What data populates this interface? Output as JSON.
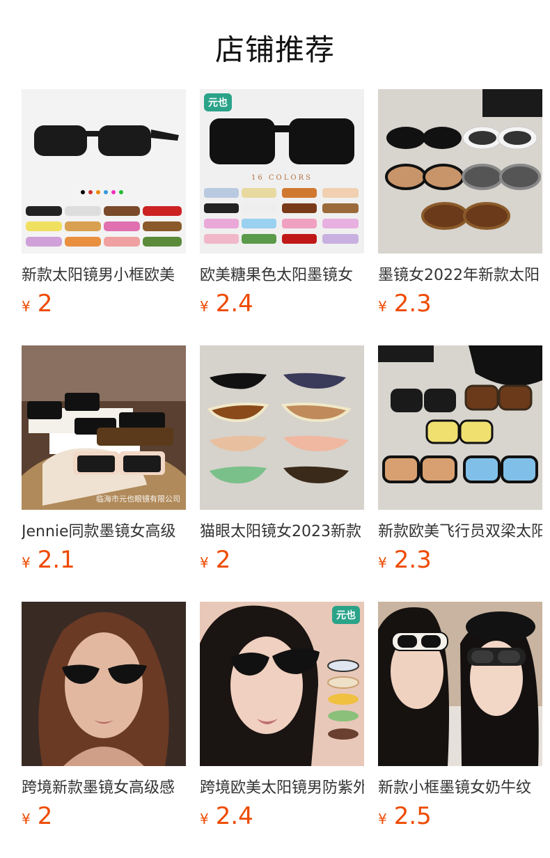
{
  "header": {
    "title": "店铺推荐"
  },
  "currency": "¥",
  "products": [
    {
      "name": "新款太阳镜男小框欧美",
      "price": "2",
      "image": "black-rectangle-sunglasses-colors",
      "badge": ""
    },
    {
      "name": "欧美糖果色太阳墨镜女",
      "price": "2.4",
      "image": "black-square-sunglasses-16-colors",
      "badge": "元也",
      "caption": "16 COLORS"
    },
    {
      "name": "墨镜女2022年新款太阳",
      "price": "2.3",
      "image": "oval-sunglasses-flatlay",
      "badge": ""
    },
    {
      "name": "Jennie同款墨镜女高级",
      "price": "2.1",
      "image": "sunglasses-on-boxes",
      "badge": "",
      "watermark": "临海市元也眼镜有限公司"
    },
    {
      "name": "猫眼太阳镜女2023新款",
      "price": "2",
      "image": "cat-eye-sunglasses-flatlay",
      "badge": ""
    },
    {
      "name": "新款欧美飞行员双梁太阳",
      "price": "2.3",
      "image": "aviator-double-bridge-flatlay",
      "badge": ""
    },
    {
      "name": "跨境新款墨镜女高级感",
      "price": "2",
      "image": "model-woman-cat-eye",
      "badge": ""
    },
    {
      "name": "跨境欧美太阳镜男防紫外",
      "price": "2.4",
      "image": "model-woman-oval-sunglasses",
      "badge": "元也"
    },
    {
      "name": "新款小框墨镜女奶牛纹",
      "price": "2.5",
      "image": "two-women-selfie-sunglasses",
      "badge": ""
    }
  ]
}
